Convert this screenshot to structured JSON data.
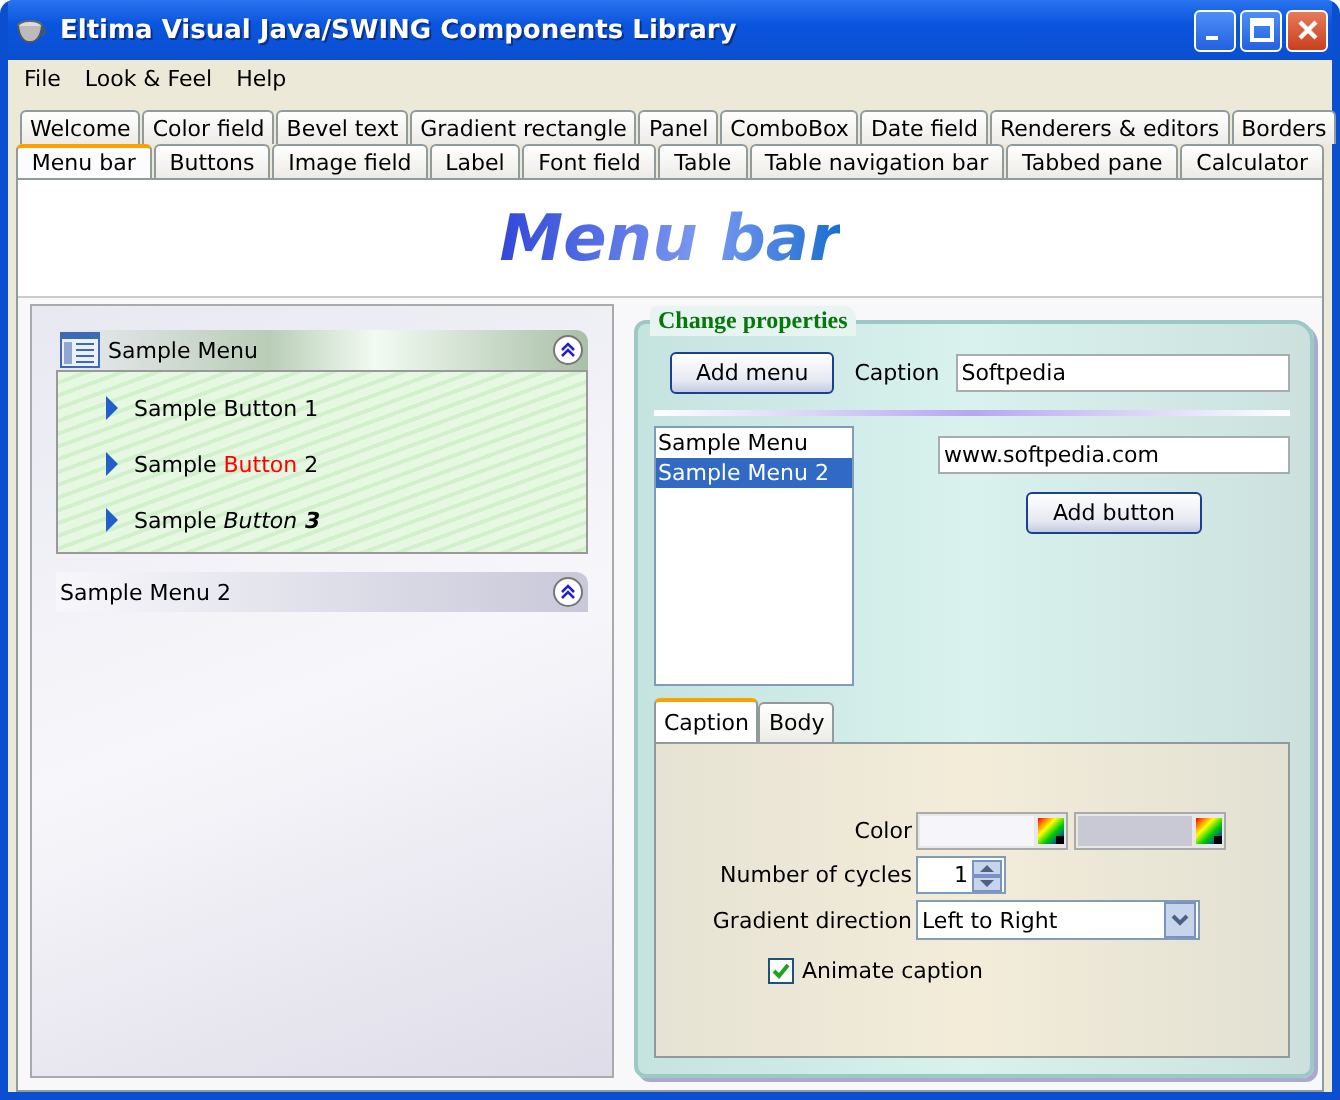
{
  "window": {
    "title": "Eltima Visual Java/SWING Components Library"
  },
  "menu_bar": [
    "File",
    "Look & Feel",
    "Help"
  ],
  "tab_rows": [
    [
      {
        "label": "Welcome",
        "selected": false
      },
      {
        "label": "Color field",
        "selected": false
      },
      {
        "label": "Bevel text",
        "selected": false
      },
      {
        "label": "Gradient rectangle",
        "selected": false
      },
      {
        "label": "Panel",
        "selected": false
      },
      {
        "label": "ComboBox",
        "selected": false
      },
      {
        "label": "Date field",
        "selected": false
      },
      {
        "label": "Renderers & editors",
        "selected": false
      },
      {
        "label": "Borders",
        "selected": false
      }
    ],
    [
      {
        "label": "Menu bar",
        "selected": true
      },
      {
        "label": "Buttons",
        "selected": false
      },
      {
        "label": "Image field",
        "selected": false
      },
      {
        "label": "Label",
        "selected": false
      },
      {
        "label": "Font field",
        "selected": false
      },
      {
        "label": "Table",
        "selected": false
      },
      {
        "label": "Table navigation bar",
        "selected": false
      },
      {
        "label": "Tabbed pane",
        "selected": false
      },
      {
        "label": "Calculator",
        "selected": false
      }
    ]
  ],
  "heading": "Menu bar",
  "sample_menus": [
    {
      "title": "Sample Menu",
      "expanded": true,
      "items": [
        [
          {
            "text": "Sample Button 1",
            "kind": "plain"
          }
        ],
        [
          {
            "text": "Sample ",
            "kind": "plain"
          },
          {
            "text": "Button",
            "kind": "red"
          },
          {
            "text": " 2",
            "kind": "plain"
          }
        ],
        [
          {
            "text": "Sample ",
            "kind": "plain"
          },
          {
            "text": "Button",
            "kind": "italic"
          },
          {
            "text": " 3",
            "kind": "bold-italic"
          }
        ]
      ]
    },
    {
      "title": "Sample Menu 2",
      "expanded": false
    }
  ],
  "properties": {
    "legend": "Change properties",
    "add_menu": "Add menu",
    "caption_label": "Caption",
    "caption_value": "Softpedia",
    "menus_list": [
      {
        "label": "Sample Menu",
        "selected": false
      },
      {
        "label": "Sample Menu 2",
        "selected": true
      }
    ],
    "url_value": "www.softpedia.com",
    "add_button": "Add button",
    "tabs": [
      {
        "label": "Caption",
        "selected": true
      },
      {
        "label": "Body",
        "selected": false
      }
    ],
    "color_label": "Color",
    "colors": [
      {
        "color": "#f5f5fa"
      },
      {
        "color": "#c9c9d6"
      }
    ],
    "cycles_label": "Number of cycles",
    "cycles_value": "1",
    "direction_label": "Gradient direction",
    "direction_value": "Left to Right",
    "animate_label": "Animate caption",
    "animate_checked": true
  }
}
